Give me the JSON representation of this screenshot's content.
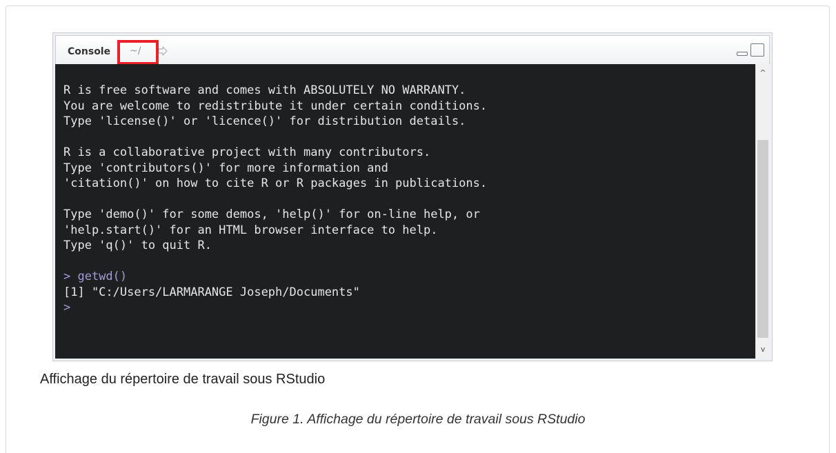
{
  "pane": {
    "tab_title": "Console",
    "working_dir": "~/",
    "goto_icon": "go-to-directory-icon"
  },
  "console": {
    "lines": [
      {
        "text": "R is free software and comes with ABSOLUTELY NO WARRANTY.",
        "kind": "output"
      },
      {
        "text": "You are welcome to redistribute it under certain conditions.",
        "kind": "output"
      },
      {
        "text": "Type 'license()' or 'licence()' for distribution details.",
        "kind": "output"
      },
      {
        "text": "",
        "kind": "blank"
      },
      {
        "text": "R is a collaborative project with many contributors.",
        "kind": "output"
      },
      {
        "text": "Type 'contributors()' for more information and",
        "kind": "output"
      },
      {
        "text": "'citation()' on how to cite R or R packages in publications.",
        "kind": "output"
      },
      {
        "text": "",
        "kind": "blank"
      },
      {
        "text": "Type 'demo()' for some demos, 'help()' for on-line help, or",
        "kind": "output"
      },
      {
        "text": "'help.start()' for an HTML browser interface to help.",
        "kind": "output"
      },
      {
        "text": "Type 'q()' to quit R.",
        "kind": "output"
      },
      {
        "text": "",
        "kind": "blank"
      },
      {
        "text": "> getwd()",
        "kind": "command"
      },
      {
        "text": "[1] \"C:/Users/LARMARANGE Joseph/Documents\"",
        "kind": "output"
      },
      {
        "text": ">",
        "kind": "command"
      }
    ],
    "colors": {
      "background": "#1d1f21",
      "text": "#e6e6e6",
      "command": "#a59ad8"
    }
  },
  "highlight_color": "#e8202a",
  "alt_text": "Affichage du répertoire de travail sous RStudio",
  "caption": "Figure 1. Affichage du répertoire de travail sous RStudio"
}
